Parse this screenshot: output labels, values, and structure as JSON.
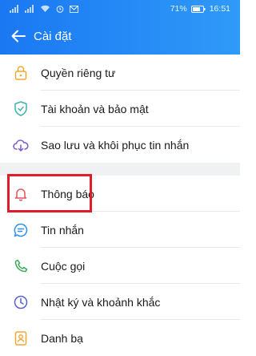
{
  "status": {
    "battery": "71%",
    "time": "16:51"
  },
  "header": {
    "title": "Cài đặt"
  },
  "section1": [
    {
      "label": "Quyền riêng tư",
      "icon": "lock-icon"
    },
    {
      "label": "Tài khoản và bảo mật",
      "icon": "shield-icon"
    },
    {
      "label": "Sao lưu và khôi phục tin nhắn",
      "icon": "cloud-sync-icon"
    }
  ],
  "section2": [
    {
      "label": "Thông báo",
      "icon": "bell-icon"
    },
    {
      "label": "Tin nhắn",
      "icon": "chat-bubble-icon"
    },
    {
      "label": "Cuộc gọi",
      "icon": "phone-icon"
    },
    {
      "label": "Nhật ký và khoảnh khắc",
      "icon": "clock-icon"
    },
    {
      "label": "Danh bạ",
      "icon": "contacts-icon"
    }
  ],
  "colors": {
    "header": "#1a78f2",
    "icon_accent": "#3fb3a8",
    "bell": "#e8545d",
    "phone": "#3aa858",
    "clock": "#5a63c8",
    "contacts": "#f0a830",
    "highlight": "#e21b2a"
  }
}
